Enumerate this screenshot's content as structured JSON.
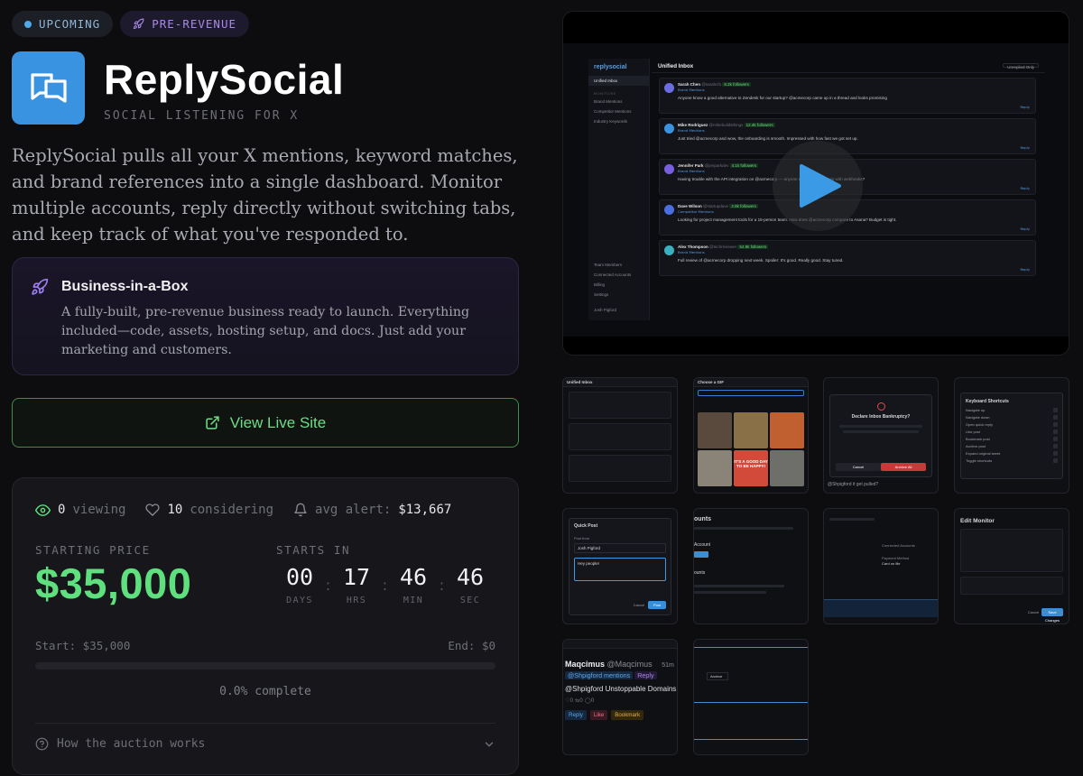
{
  "badges": {
    "upcoming": "UPCOMING",
    "pre_revenue": "PRE-REVENUE"
  },
  "brand": {
    "name": "ReplySocial",
    "tagline": "SOCIAL LISTENING FOR X",
    "logo_icon": "chat-bubbles-icon"
  },
  "description": "ReplySocial pulls all your X mentions, keyword matches, and brand references into a single dashboard. Monitor multiple accounts, reply directly without switching tabs, and keep track of what you've responded to.",
  "business_box": {
    "title": "Business-in-a-Box",
    "body": "A fully-built, pre-revenue business ready to launch. Everything included—code, assets, hosting setup, and docs. Just add your marketing and customers."
  },
  "live_site": {
    "label": "View Live Site"
  },
  "auction": {
    "viewing_count": "0",
    "viewing_label": "viewing",
    "considering_count": "10",
    "considering_label": "considering",
    "avg_alert_label": "avg alert:",
    "avg_alert_value": "$13,667",
    "starting_price_label": "STARTING PRICE",
    "starting_price": "$35,000",
    "starts_in_label": "STARTS IN",
    "countdown": {
      "days": "00",
      "days_label": "DAYS",
      "hrs": "17",
      "hrs_label": "HRS",
      "min": "46",
      "min_label": "MIN",
      "sec": "46",
      "sec_label": "SEC"
    },
    "start_label": "Start: $35,000",
    "end_label": "End: $0",
    "progress_fraction": 0.0,
    "progress_text": "0.0% complete",
    "how_it_works": "How the auction works"
  },
  "video_preview": {
    "app_logo": "replysocial",
    "header_title": "Unified Inbox",
    "filter": "Unreplied Only",
    "sidebar": {
      "items": [
        "Unified Inbox",
        "Brand Mentions",
        "Competitor Mentions",
        "Industry Keywords"
      ],
      "bottom_items": [
        "Team Members",
        "Connected Accounts",
        "Billing",
        "Settings"
      ],
      "user": "Josh Pigford",
      "section": "MONITORS"
    },
    "posts": [
      {
        "name": "Sarah Chen",
        "handle": "@sarahcfo",
        "followers": "8.2k followers",
        "tag": "Brand Mentions",
        "text": "Anyone know a good alternative to Zendesk for our startup? @acmecorp came up in a thread and looks promising",
        "color": "#6a6ee0"
      },
      {
        "name": "Mike Rodriguez",
        "handle": "@mikebuildsthings",
        "followers": "12.4k followers",
        "tag": "Brand Mentions",
        "text": "Just tried @acmecorp and wow, the onboarding is smooth. Impressed with how fast we got set up.",
        "color": "#3a93e0"
      },
      {
        "name": "Jennifer Park",
        "handle": "@jenparkdev",
        "followers": "4.1k followers",
        "tag": "Brand Mentions",
        "text": "Having trouble with the API integration on @acmecorp — anyone else run into issues with webhooks?",
        "color": "#7a5ee0"
      },
      {
        "name": "Dave Wilson",
        "handle": "@startupdave",
        "followers": "2.8k followers",
        "tag": "Competitor Mentions",
        "text": "Looking for project management tools for a 15-person team. How does @acmecorp compare to Asana? Budget is tight.",
        "color": "#4a6ee0"
      },
      {
        "name": "Alex Thompson",
        "handle": "@techreviewer",
        "followers": "54.8k followers",
        "tag": "Brand Mentions",
        "text": "Full review of @acmecorp dropping next week. Spoiler: It's good. Really good. Stay tuned.",
        "color": "#3ab0c0"
      }
    ],
    "reply_label": "Reply",
    "play_icon": "play-icon"
  },
  "thumbnails": {
    "t1_header": "Unified Inbox",
    "t2_header": "Choose a GIF",
    "t2_gif_text": "IT'S A GOOD DAY TO BE HAPPY!",
    "t3_title": "Declare Inbox Bankruptcy?",
    "t3_cancel": "Cancel",
    "t3_confirm": "Archive All",
    "t3_footer": "@Shpigford it get pulled?",
    "t4_title": "Keyboard Shortcuts",
    "t4_items": [
      "Navigate up",
      "Navigate down",
      "Open quick reply",
      "Like post",
      "Bookmark post",
      "Archive post",
      "Expand original tweet",
      "Toggle shortcuts"
    ],
    "t5_title": "Quick Post",
    "t5_from": "Post from",
    "t5_user": "Josh Pigford",
    "t5_text": "Hey people!",
    "t5_cancel": "Cancel",
    "t5_post": "Post",
    "t6_title": "ounts",
    "t6_sub": "Account",
    "t6_sub2": "ounts",
    "t7_label1": "Connected Accounts",
    "t7_label2": "Payment Method",
    "t7_value2": "Card on file",
    "t8_title": "Edit Monitor",
    "t8_cancel": "Cancel",
    "t8_save": "Save Changes",
    "t9_name": "Maqcimus",
    "t9_handle": "@Maqcimus",
    "t9_time": "51m",
    "t9_tag1": "@Shpigford mentions",
    "t9_tag2": "Reply",
    "t9_text": "@Shpigford Unstoppable Domains 10",
    "t9_reply": "Reply",
    "t9_like": "Like",
    "t9_bookmark": "Bookmark",
    "t10_label": "Archive"
  }
}
